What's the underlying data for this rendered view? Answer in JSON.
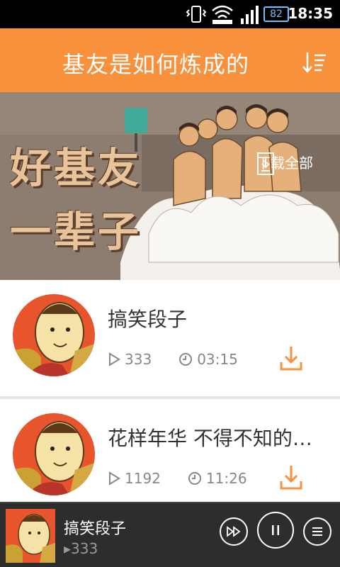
{
  "status_bar": {
    "time": "18:35",
    "battery": "82"
  },
  "header": {
    "title": "基友是如何炼成的"
  },
  "banner": {
    "headline_line1": "好基友",
    "headline_line2": "一辈子",
    "download_all_label": "下载全部"
  },
  "items": [
    {
      "title": "搞笑段子",
      "plays": "333",
      "duration": "03:15"
    },
    {
      "title": "花样年华 不得不知的…",
      "plays": "1192",
      "duration": "11:26"
    }
  ],
  "player": {
    "title": "搞笑段子",
    "plays": "333"
  },
  "colors": {
    "accent": "#f7913b",
    "player_bg": "#2d2d2d"
  }
}
